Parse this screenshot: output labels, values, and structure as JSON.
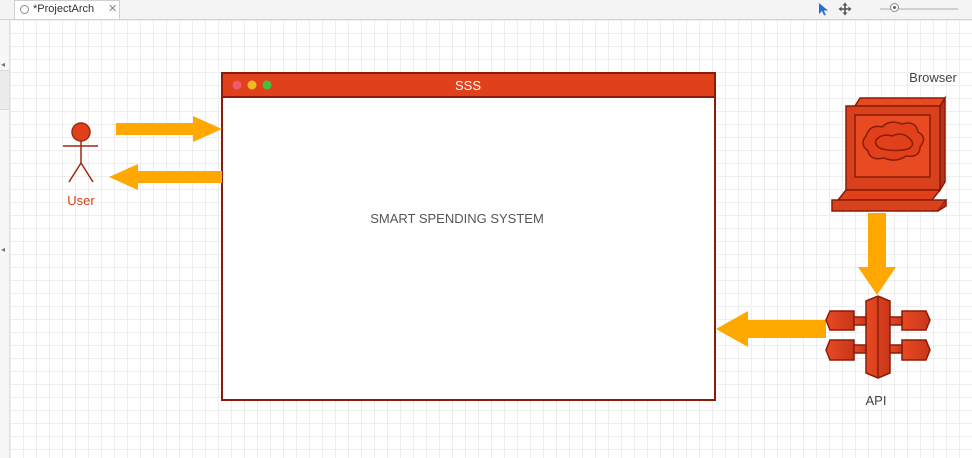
{
  "tab": {
    "title": "*ProjectArch",
    "close": "✕"
  },
  "toolbar": {
    "pointer_icon": "pointer-icon",
    "move_icon": "move-icon",
    "zoom_icon": "zoom-slider"
  },
  "diagram": {
    "window": {
      "title": "SSS",
      "body_text": "SMART SPENDING SYSTEM",
      "titlebar_color": "#e0401a",
      "dot_colors": [
        "#ee5a70",
        "#f5b91f",
        "#3fc13f"
      ]
    },
    "user": {
      "label": "User"
    },
    "browser": {
      "label": "Browser"
    },
    "api": {
      "label": "API"
    },
    "colors": {
      "arrow": "#ffa800",
      "accent": "#d9401c",
      "accent_dark": "#8a1c08"
    }
  }
}
